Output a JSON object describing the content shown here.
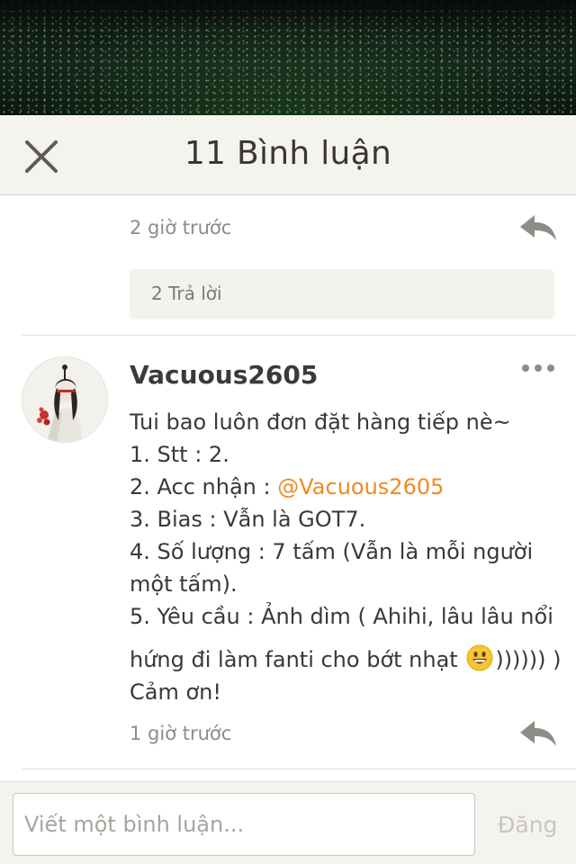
{
  "header": {
    "title": "11 Bình luận"
  },
  "previous_comment": {
    "timestamp": "2 giờ trước",
    "replies_label": "2 Trả lời"
  },
  "comment": {
    "username": "Vacuous2605",
    "lines": {
      "l1": "Tui bao luôn đơn đặt hàng tiếp nè~",
      "l2": "1. Stt : 2.",
      "l3_prefix": "2. Acc nhận : ",
      "l3_mention": "@Vacuous2605",
      "l4": "3. Bias : Vẫn là GOT7.",
      "l5": "4. Số lượng : 7 tấm (Vẫn là mỗi người",
      "l6": "một tấm).",
      "l7": "5. Yêu cầu : Ảnh dìm ( Ahihi, lâu lâu nổi",
      "l8_prefix": "hứng đi làm fanti cho bớt nhạt ",
      "l8_suffix": ")))))) )",
      "l9": "Cảm ơn!"
    },
    "timestamp": "1 giờ trước"
  },
  "composer": {
    "placeholder": "Viết một bình luận...",
    "post_label": "Đăng"
  },
  "colors": {
    "mention": "#f08a1f",
    "header_bg": "#f5f3ee",
    "icon_gray": "#8f8b86"
  },
  "icons": {
    "close": "close-icon",
    "reply": "reply-arrow-icon",
    "more": "more-dots-icon",
    "emoji": "grinning-face-emoji"
  }
}
